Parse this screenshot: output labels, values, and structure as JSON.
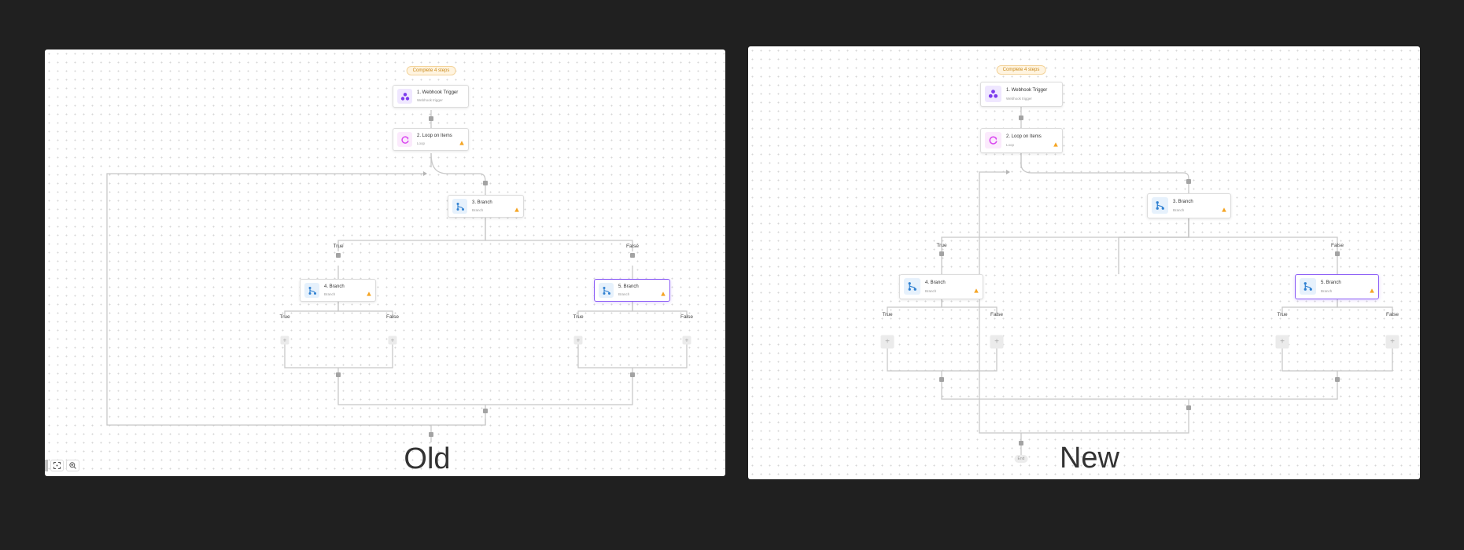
{
  "old": {
    "caption": "Old",
    "badge": "Complete 4 steps",
    "nodes": [
      {
        "title": "1. Webhook Trigger",
        "subtitle": "Webhook trigger",
        "icon": "webhook-icon"
      },
      {
        "title": "2. Loop on Items",
        "subtitle": "Loop",
        "icon": "loop-icon"
      },
      {
        "title": "3. Branch",
        "subtitle": "Branch",
        "icon": "branch-icon"
      },
      {
        "title": "4. Branch",
        "subtitle": "Branch",
        "icon": "branch-icon"
      },
      {
        "title": "5. Branch",
        "subtitle": "Branch",
        "icon": "branch-icon"
      }
    ],
    "labels": {
      "true": "True",
      "false": "False"
    },
    "toolbar": [
      "fit-view-icon",
      "zoom-in-icon"
    ]
  },
  "new": {
    "caption": "New",
    "badge": "Complete 4 steps",
    "nodes": [
      {
        "title": "1. Webhook Trigger",
        "subtitle": "Webhook trigger",
        "icon": "webhook-icon"
      },
      {
        "title": "2. Loop on Items",
        "subtitle": "Loop",
        "icon": "loop-icon"
      },
      {
        "title": "3. Branch",
        "subtitle": "Branch",
        "icon": "branch-icon"
      },
      {
        "title": "4. Branch",
        "subtitle": "Branch",
        "icon": "branch-icon"
      },
      {
        "title": "5. Branch",
        "subtitle": "Branch",
        "icon": "branch-icon"
      }
    ],
    "labels": {
      "true": "True",
      "false": "False"
    },
    "end_label": "End"
  },
  "colors": {
    "accent": "#8b5cf6",
    "warning": "#f5a524",
    "wire": "#c8c8c8",
    "background": "#202020"
  }
}
